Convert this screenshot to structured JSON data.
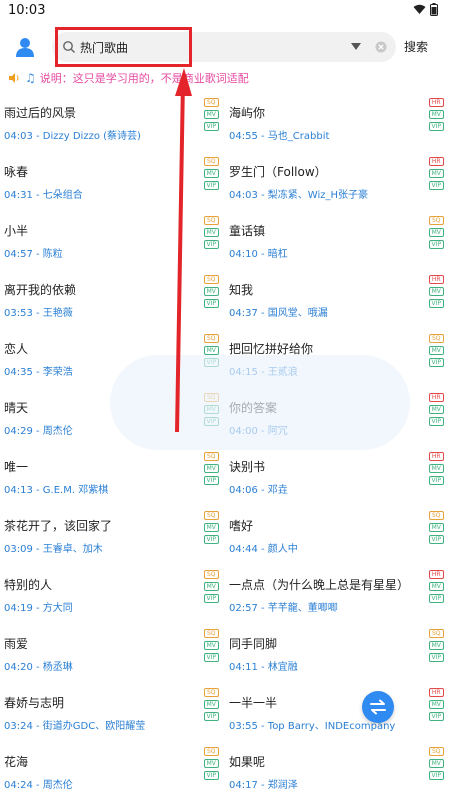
{
  "status_bar": {
    "time": "10:03"
  },
  "search": {
    "query": "热门歌曲",
    "placeholder": "热门歌曲",
    "button_label": "搜索"
  },
  "notice": {
    "note_glyph": "♫",
    "text": "说明：这只是学习用的，不是商业歌词适配"
  },
  "colors": {
    "accent": "#2a7fd4",
    "highlight": "#e3252b",
    "notice": "#e64ba0"
  },
  "songs": [
    {
      "title": "雨过后的风景",
      "meta": "04:03 - Dizzy Dizzo (蔡诗芸)",
      "badges": [
        "SQ",
        "MV",
        "VIP"
      ]
    },
    {
      "title": "海屿你",
      "meta": "04:55 - 马也_Crabbit",
      "badges": [
        "HR",
        "MV",
        "VIP"
      ]
    },
    {
      "title": "咏春",
      "meta": "04:31 - 七朵组合",
      "badges": [
        "SQ",
        "MV",
        "VIP"
      ]
    },
    {
      "title": "罗生门（Follow）",
      "meta": "04:03 - 梨冻紧、Wiz_H张子豪",
      "badges": [
        "HR",
        "MV",
        "VIP"
      ]
    },
    {
      "title": "小半",
      "meta": "04:57 - 陈粒",
      "badges": [
        "SQ",
        "MV",
        "VIP"
      ]
    },
    {
      "title": "童话镇",
      "meta": "04:10 - 暗杠",
      "badges": [
        "SQ",
        "MV",
        "VIP"
      ]
    },
    {
      "title": "离开我的依赖",
      "meta": "03:53 - 王艳薇",
      "badges": [
        "SQ",
        "MV",
        "VIP"
      ]
    },
    {
      "title": "知我",
      "meta": "04:37 - 国风堂、哦漏",
      "badges": [
        "HR",
        "MV",
        "VIP"
      ]
    },
    {
      "title": "恋人",
      "meta": "04:35 - 李荣浩",
      "badges": [
        "SQ",
        "MV",
        "VIP"
      ]
    },
    {
      "title": "把回忆拼好给你",
      "meta": "04:15 - 王贰浪",
      "badges": [
        "SQ",
        "MV",
        "VIP"
      ]
    },
    {
      "title": "晴天",
      "meta": "04:29 - 周杰伦",
      "badges": [
        "SQ",
        "MV",
        "VIP"
      ]
    },
    {
      "title": "你的答案",
      "meta": "04:00 - 阿冗",
      "badges": [
        "HR",
        "MV",
        "VIP"
      ]
    },
    {
      "title": "唯一",
      "meta": "04:13 - G.E.M. 邓紫棋",
      "badges": [
        "SQ",
        "MV",
        "VIP"
      ]
    },
    {
      "title": "诀别书",
      "meta": "04:06 - 邓垚",
      "badges": [
        "HR",
        "MV",
        "VIP"
      ]
    },
    {
      "title": "茶花开了，该回家了",
      "meta": "03:09 - 王睿卓、加木",
      "badges": [
        "SQ",
        "MV",
        "VIP"
      ]
    },
    {
      "title": "嗜好",
      "meta": "04:44 - 颜人中",
      "badges": [
        "SQ",
        "MV",
        "VIP"
      ]
    },
    {
      "title": "特别的人",
      "meta": "04:19 - 方大同",
      "badges": [
        "SQ",
        "MV",
        "VIP"
      ]
    },
    {
      "title": "一点点（为什么晚上总是有星星）",
      "meta": "02:57 - 芊芊龍、董唧唧",
      "badges": [
        "HR",
        "MV",
        "VIP"
      ]
    },
    {
      "title": "雨爱",
      "meta": "04:20 - 杨丞琳",
      "badges": [
        "SQ",
        "MV",
        "VIP"
      ]
    },
    {
      "title": "同手同脚",
      "meta": "04:11 - 林宜融",
      "badges": [
        "SQ",
        "MV",
        "VIP"
      ]
    },
    {
      "title": "春娇与志明",
      "meta": "03:24 - 街道办GDC、欧阳耀莹",
      "badges": [
        "SQ",
        "MV",
        "VIP"
      ]
    },
    {
      "title": "一半一半",
      "meta": "03:55 - Top Barry、INDEcompany",
      "badges": [
        "HR",
        "MV",
        "VIP"
      ]
    },
    {
      "title": "花海",
      "meta": "04:24 - 周杰伦",
      "badges": [
        "SQ",
        "MV",
        "VIP"
      ]
    },
    {
      "title": "如果呢",
      "meta": "04:17 - 郑润泽",
      "badges": [
        "SQ",
        "MV",
        "VIP"
      ]
    }
  ]
}
